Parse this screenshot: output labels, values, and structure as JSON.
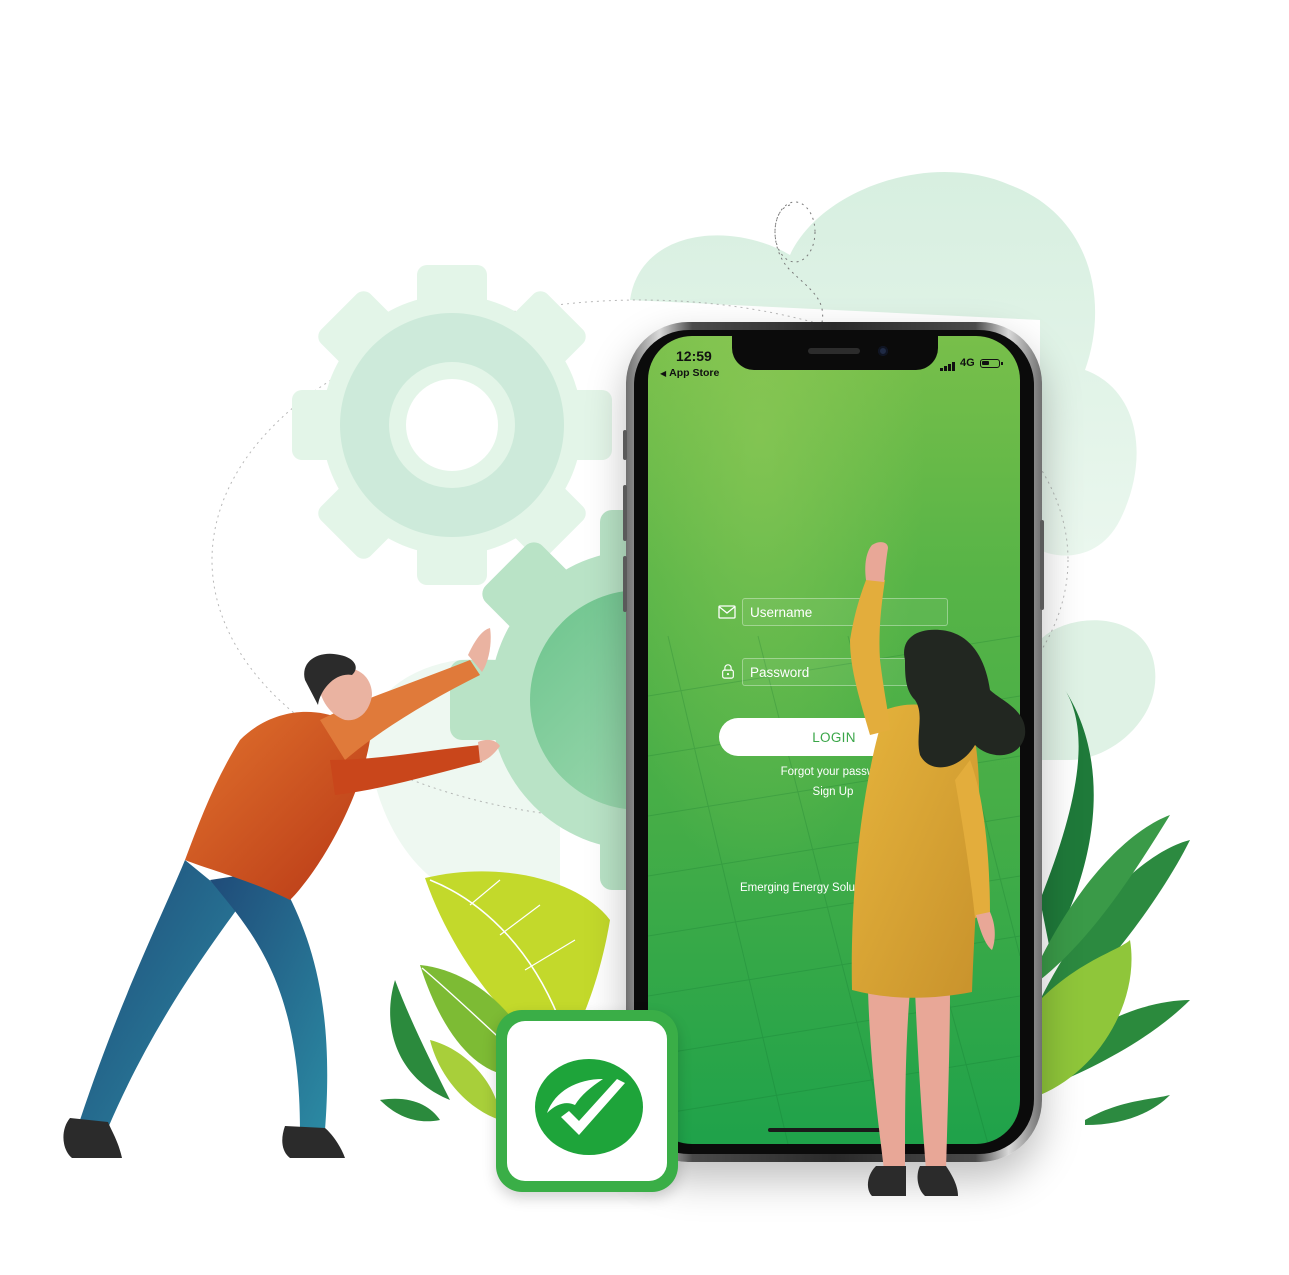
{
  "status_bar": {
    "time": "12:59",
    "back_label": "App Store",
    "network": "4G"
  },
  "login_form": {
    "username_placeholder": "Username",
    "password_placeholder": "Password",
    "login_label": "LOGIN",
    "forgot_label": "Forgot your passwor",
    "signup_label": "Sign Up"
  },
  "tagline": "Emerging Energy Solu",
  "icons": {
    "username": "envelope-icon",
    "password": "lock-icon",
    "app": "checkmark-icon",
    "back": "back-triangle-icon"
  },
  "colors": {
    "brand_green": "#3aae47",
    "screen_top": "#78bf4a",
    "screen_bottom": "#1fa24a",
    "login_text": "#3aa648",
    "man_shirt": "#d2521c",
    "man_jeans": "#25708f",
    "woman_dress": "#dca534"
  }
}
